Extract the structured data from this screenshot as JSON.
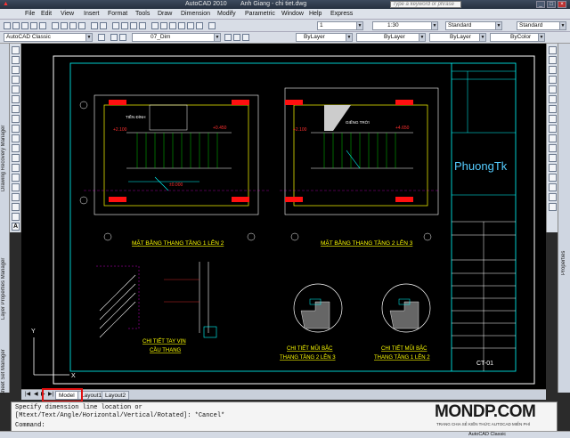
{
  "titlebar": {
    "app_title": "AutoCAD 2010",
    "doc_title": "Anh Giang - chi tiet.dwg",
    "search_placeholder": "Type a keyword or phrase"
  },
  "menu": [
    "File",
    "Edit",
    "View",
    "Insert",
    "Format",
    "Tools",
    "Draw",
    "Dimension",
    "Modify",
    "Parametric",
    "Window",
    "Help",
    "Express"
  ],
  "toolbar1": {
    "scale": "1:30",
    "layer_number": "1",
    "text_style": "Standard",
    "dim_style": "Standard"
  },
  "toolbar2": {
    "workspace": "AutoCAD Classic",
    "layer": "07_Dim",
    "color": "ByLayer",
    "linetype": "ByLayer",
    "lineweight": "ByLayer",
    "plotstyle": "ByColor"
  },
  "left_palettes": [
    "Drawing Recovery Manager",
    "Layer Properties Manager",
    "Sheet Set Manager"
  ],
  "right_palettes": [
    "Properties"
  ],
  "drawing": {
    "title_1": "MẶT BẰNG THANG TẦNG 1 LÊN 2",
    "title_2": "MẶT BẰNG THANG TẦNG 2 LÊN 3",
    "detail_1a": "CHI TIẾT TAY VỊN",
    "detail_1b": "CẦU THANG",
    "detail_2a": "CHI TIẾT MŨI BẬC",
    "detail_2b": "THANG TẦNG 2 LÊN 3",
    "detail_3a": "CHI TIẾT MŨI BẬC",
    "detail_3b": "THANG TẦNG 1 LÊN 2",
    "watermark": "PhuongTk",
    "sheet_no": "CT-01",
    "label_tiendinh": "TIỀN ĐÌNH",
    "label_giengtroi": "GIẾNG TRỜI",
    "level_a": "+2.100",
    "level_b": "+0.450",
    "level_c": "±0.000",
    "level_d": "+2.100",
    "level_e": "+4.650"
  },
  "tabs": [
    "Model",
    "Layout1",
    "Layout2"
  ],
  "command": {
    "line1": "Specify dimension line location or",
    "line2": "[Mtext/Text/Angle/Horizontal/Vertical/Rotated]: *Cancel*",
    "prompt": "Command:"
  },
  "branding": {
    "logo": "MONDP.COM",
    "tagline": "TRANG CHIA SẺ KIẾN THỨC AUTOCAD MIỄN PHÍ"
  },
  "statusbar": {
    "workspace": "AutoCAD Classic"
  }
}
